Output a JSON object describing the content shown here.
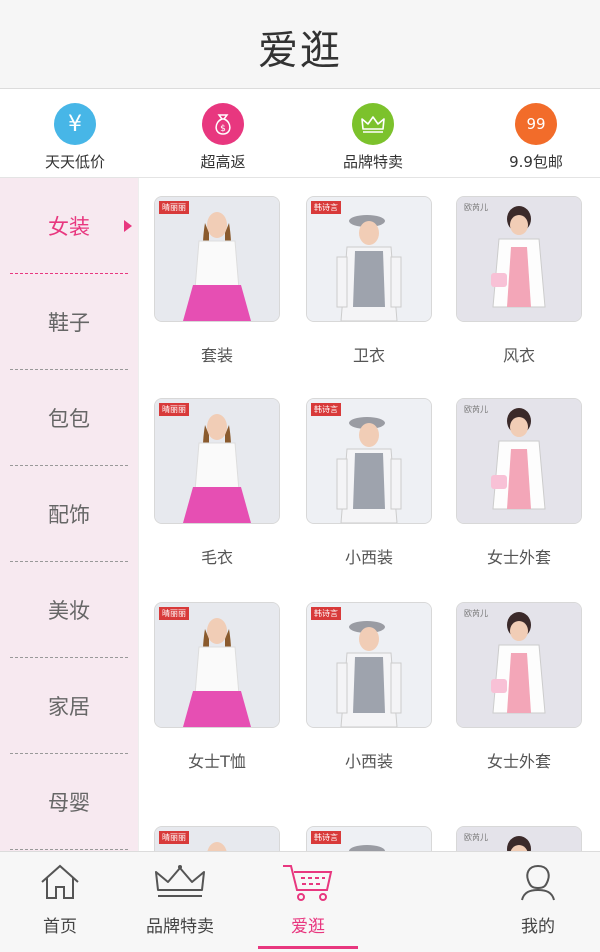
{
  "header": {
    "title": "爱逛"
  },
  "quick_links": [
    {
      "label": "天天低价",
      "icon": "yuan-icon",
      "color": "#47b6e7"
    },
    {
      "label": "超高返",
      "icon": "money-bag-icon",
      "color": "#e8377f"
    },
    {
      "label": "品牌特卖",
      "icon": "crown-icon",
      "color": "#7cc22c"
    },
    {
      "label": "9.9包邮",
      "icon": "99-icon",
      "color": "#f26c2a"
    }
  ],
  "sidebar": {
    "items": [
      "女装",
      "鞋子",
      "包包",
      "配饰",
      "美妆",
      "家居",
      "母婴"
    ],
    "active_index": 0
  },
  "products": [
    {
      "label": "套装",
      "badge": "晴丽丽"
    },
    {
      "label": "卫衣",
      "badge": "韩诗言"
    },
    {
      "label": "风衣",
      "badge": "欧芮儿"
    },
    {
      "label": "毛衣",
      "badge": "晴丽丽"
    },
    {
      "label": "小西装",
      "badge": "韩诗言"
    },
    {
      "label": "女士外套",
      "badge": "欧芮儿"
    },
    {
      "label": "女士T恤",
      "badge": "晴丽丽"
    },
    {
      "label": "小西装",
      "badge": "韩诗言"
    },
    {
      "label": "女士外套",
      "badge": "欧芮儿"
    },
    {
      "label": "",
      "badge": "晴丽丽"
    },
    {
      "label": "",
      "badge": "韩诗言"
    },
    {
      "label": "",
      "badge": "欧芮儿"
    }
  ],
  "tabbar": {
    "items": [
      {
        "label": "首页",
        "icon": "home-icon"
      },
      {
        "label": "品牌特卖",
        "icon": "crown-icon"
      },
      {
        "label": "爱逛",
        "icon": "cart-icon"
      },
      {
        "label": "",
        "icon": ""
      },
      {
        "label": "我的",
        "icon": "user-icon"
      }
    ],
    "active_index": 2
  },
  "colors": {
    "accent": "#e8377f",
    "sidebar_bg": "#f7e9f0"
  }
}
